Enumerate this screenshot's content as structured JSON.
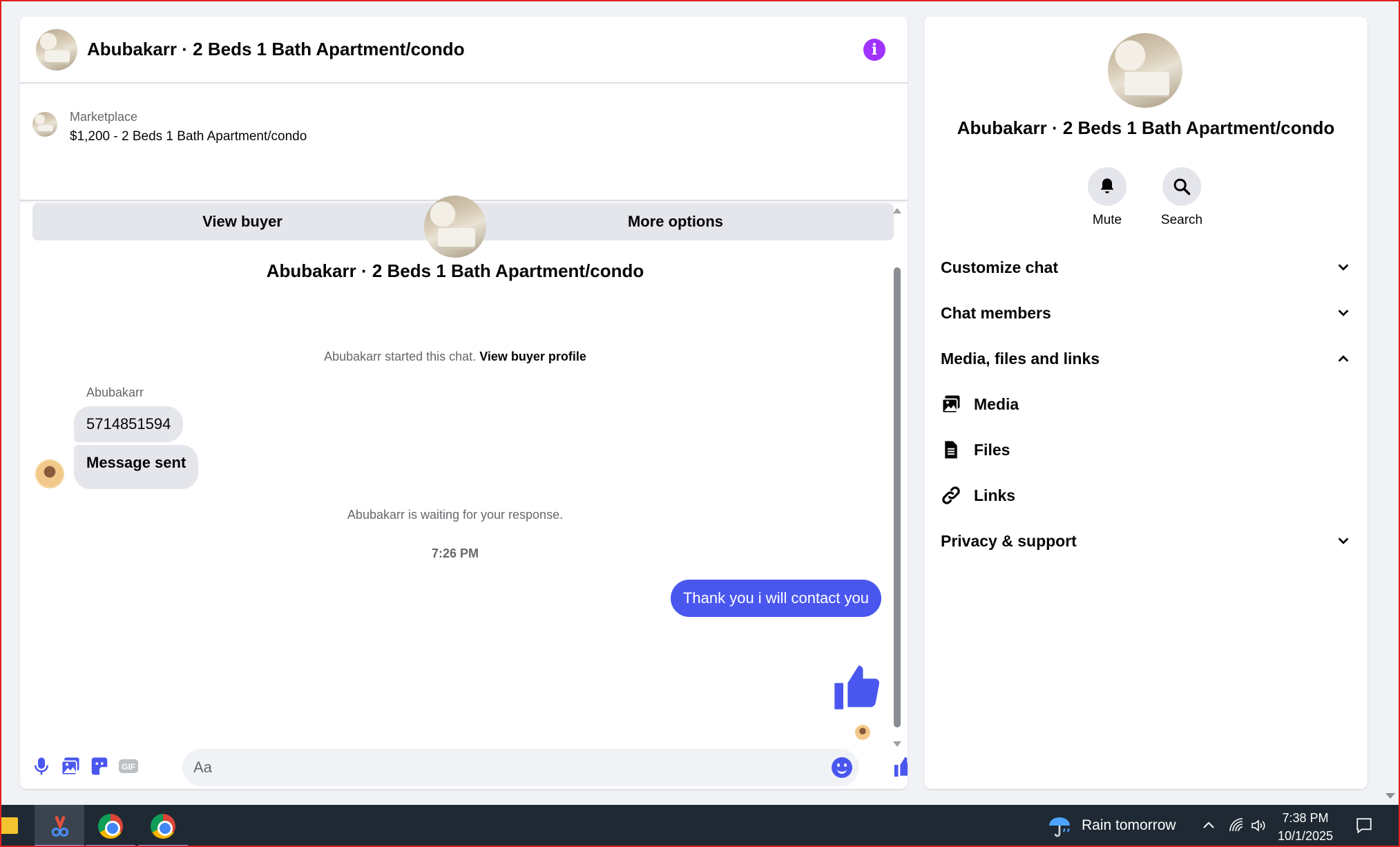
{
  "chat": {
    "title": "Abubakarr · 2 Beds 1 Bath Apartment/condo",
    "marketplace": {
      "label": "Marketplace",
      "listing": "$1,200 - 2 Beds 1 Bath Apartment/condo",
      "view_buyer": "View buyer",
      "more_options": "More options"
    },
    "intro_title": "Abubakarr · 2 Beds 1 Bath Apartment/condo",
    "started_text": "Abubakarr started this chat.",
    "view_profile": "View buyer profile",
    "sender_name": "Abubakarr",
    "messages_in": [
      "5714851594",
      "Message sent"
    ],
    "waiting_text": "Abubakarr is waiting for your response.",
    "timestamp": "7:26 PM",
    "message_out": "Thank you i will contact you",
    "composer_placeholder": "Aa"
  },
  "info": {
    "title": "Abubakarr · 2 Beds 1 Bath Apartment/condo",
    "actions": {
      "mute": "Mute",
      "search": "Search"
    },
    "sections": {
      "customize": "Customize chat",
      "members": "Chat members",
      "media_files_links": "Media, files and links",
      "privacy": "Privacy & support"
    },
    "media_items": {
      "media": "Media",
      "files": "Files",
      "links": "Links"
    }
  },
  "taskbar": {
    "weather": "Rain tomorrow",
    "time": "7:38 PM",
    "date": "10/1/2025"
  },
  "colors": {
    "accent": "#4a57ef",
    "info_icon": "#a033ff",
    "bubble_in": "#e4e6eb"
  }
}
